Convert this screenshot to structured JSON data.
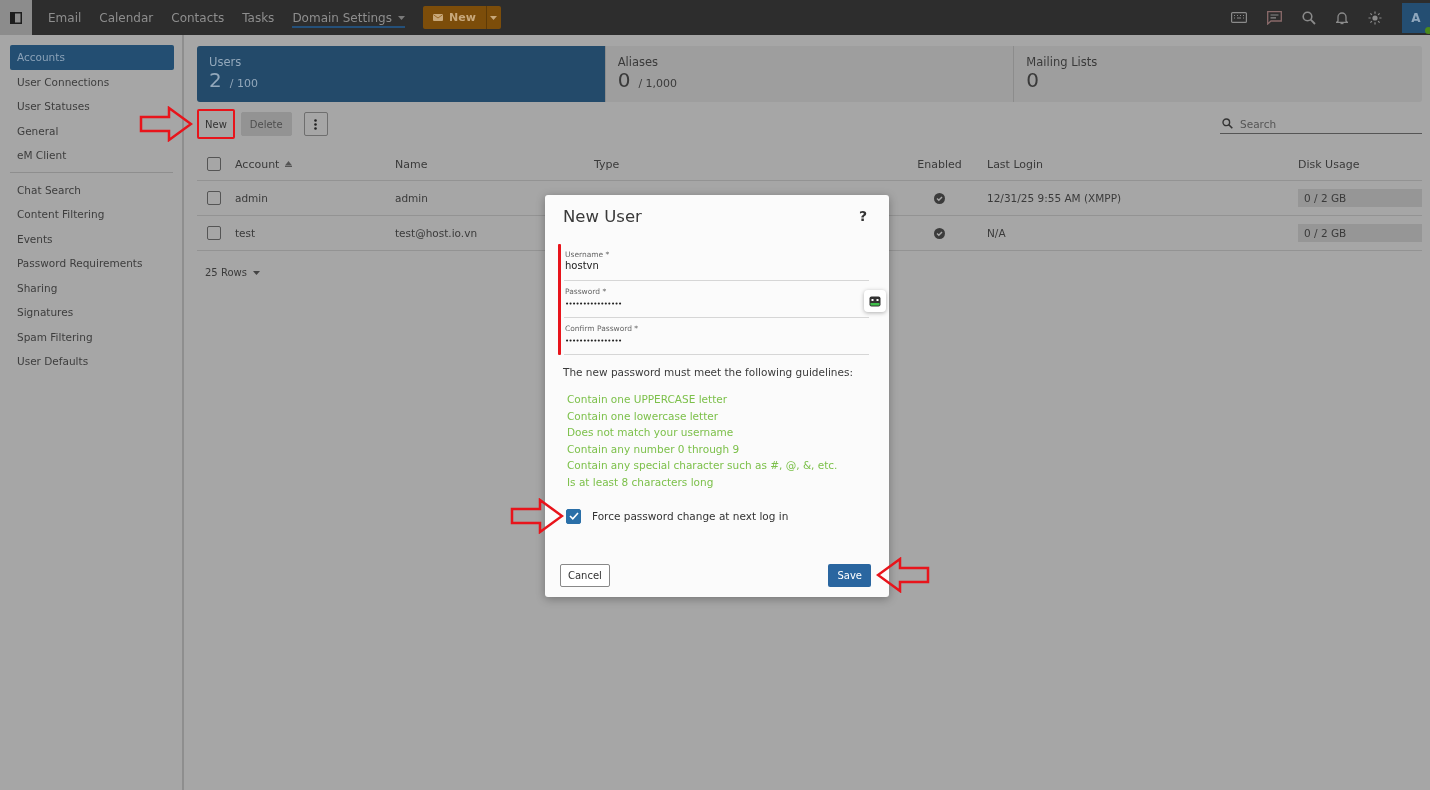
{
  "nav": {
    "items": [
      {
        "label": "Email",
        "selected": false,
        "dropdown": false
      },
      {
        "label": "Calendar",
        "selected": false,
        "dropdown": false
      },
      {
        "label": "Contacts",
        "selected": false,
        "dropdown": false
      },
      {
        "label": "Tasks",
        "selected": false,
        "dropdown": false
      },
      {
        "label": "Domain Settings",
        "selected": true,
        "dropdown": true
      }
    ],
    "new_button": {
      "label": "New"
    },
    "avatar": {
      "initial": "A",
      "online": true
    }
  },
  "sidebar": {
    "groups": [
      [
        {
          "label": "Accounts",
          "selected": true
        },
        {
          "label": "User Connections",
          "selected": false
        },
        {
          "label": "User Statuses",
          "selected": false
        },
        {
          "label": "General",
          "selected": false
        },
        {
          "label": "eM Client",
          "selected": false
        }
      ],
      [
        {
          "label": "Chat Search",
          "selected": false
        },
        {
          "label": "Content Filtering",
          "selected": false
        },
        {
          "label": "Events",
          "selected": false
        },
        {
          "label": "Password Requirements",
          "selected": false
        },
        {
          "label": "Sharing",
          "selected": false
        },
        {
          "label": "Signatures",
          "selected": false
        },
        {
          "label": "Spam Filtering",
          "selected": false
        },
        {
          "label": "User Defaults",
          "selected": false
        }
      ]
    ]
  },
  "stats": [
    {
      "label": "Users",
      "count": "2",
      "limit": "/ 100",
      "selected": true
    },
    {
      "label": "Aliases",
      "count": "0",
      "limit": "/ 1,000",
      "selected": false
    },
    {
      "label": "Mailing Lists",
      "count": "0",
      "selected": false
    }
  ],
  "toolbar": {
    "buttons": [
      {
        "label": "New",
        "disabled": false,
        "annotated": true
      },
      {
        "label": "Delete",
        "disabled": true,
        "annotated": false
      }
    ],
    "search": {
      "placeholder": "Search"
    }
  },
  "table": {
    "select_all_checked": false,
    "columns": [
      {
        "label": "Account",
        "sorted": true
      },
      {
        "label": "Name",
        "sorted": false
      },
      {
        "label": "Type",
        "sorted": false
      },
      {
        "label": "Enabled",
        "sorted": false
      },
      {
        "label": "Last Login",
        "sorted": false
      },
      {
        "label": "Disk Usage",
        "sorted": false
      }
    ],
    "rows": [
      {
        "checked": false,
        "account": "admin",
        "name": "admin",
        "enabled": true,
        "last_login": "12/31/25 9:55 AM (XMPP)",
        "disk_usage": "0 / 2 GB"
      },
      {
        "checked": false,
        "account": "test",
        "name": "test@host.io.vn",
        "enabled": true,
        "last_login": "N/A",
        "disk_usage": "0 / 2 GB"
      }
    ],
    "page_size": "25 Rows"
  },
  "dialog": {
    "title": "New User",
    "help": "?",
    "fields_annotated": true,
    "fields": [
      {
        "label": "Username *",
        "value": "hostvn",
        "kind": "text"
      },
      {
        "label": "Password *",
        "value": "••••••••••••••••",
        "kind": "password"
      },
      {
        "label": "Confirm Password *",
        "value": "••••••••••••••••",
        "kind": "password"
      }
    ],
    "intro": "The new password must meet the following guidelines:",
    "guidelines": [
      {
        "text": "Contain one UPPERCASE letter",
        "met": true
      },
      {
        "text": "Contain one lowercase letter",
        "met": true
      },
      {
        "text": "Does not match your username",
        "met": true
      },
      {
        "text": "Contain any number 0 through 9",
        "met": true
      },
      {
        "text": "Contain any special character such as #, @, &, etc.",
        "met": true
      },
      {
        "text": "Is at least 8 characters long",
        "met": true
      }
    ],
    "force_change": {
      "label": "Force password change at next log in",
      "checked": true,
      "annotated": true
    },
    "cancel": {
      "label": "Cancel"
    },
    "save": {
      "label": "Save",
      "annotated": true
    }
  }
}
